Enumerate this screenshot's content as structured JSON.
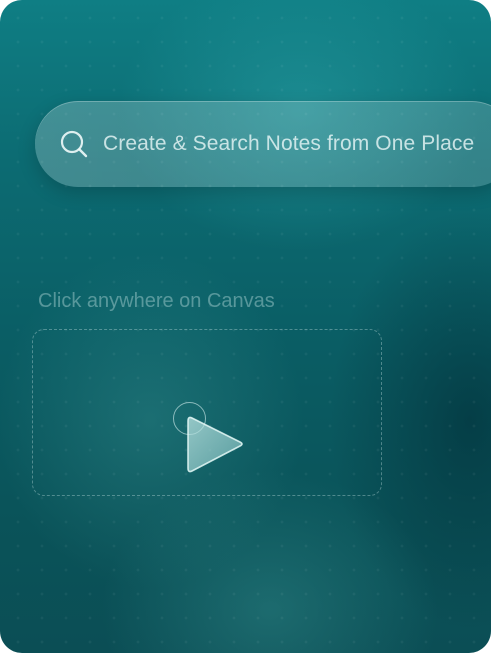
{
  "search": {
    "text": "Create & Search Notes from One Place",
    "icon": "search-icon"
  },
  "canvas": {
    "label": "Click anywhere on Canvas",
    "cursor_icon": "play-cursor-icon"
  },
  "colors": {
    "background_top": "#0f7e84",
    "background_bottom": "#0b4e55",
    "search_text": "#e6f5f5"
  }
}
